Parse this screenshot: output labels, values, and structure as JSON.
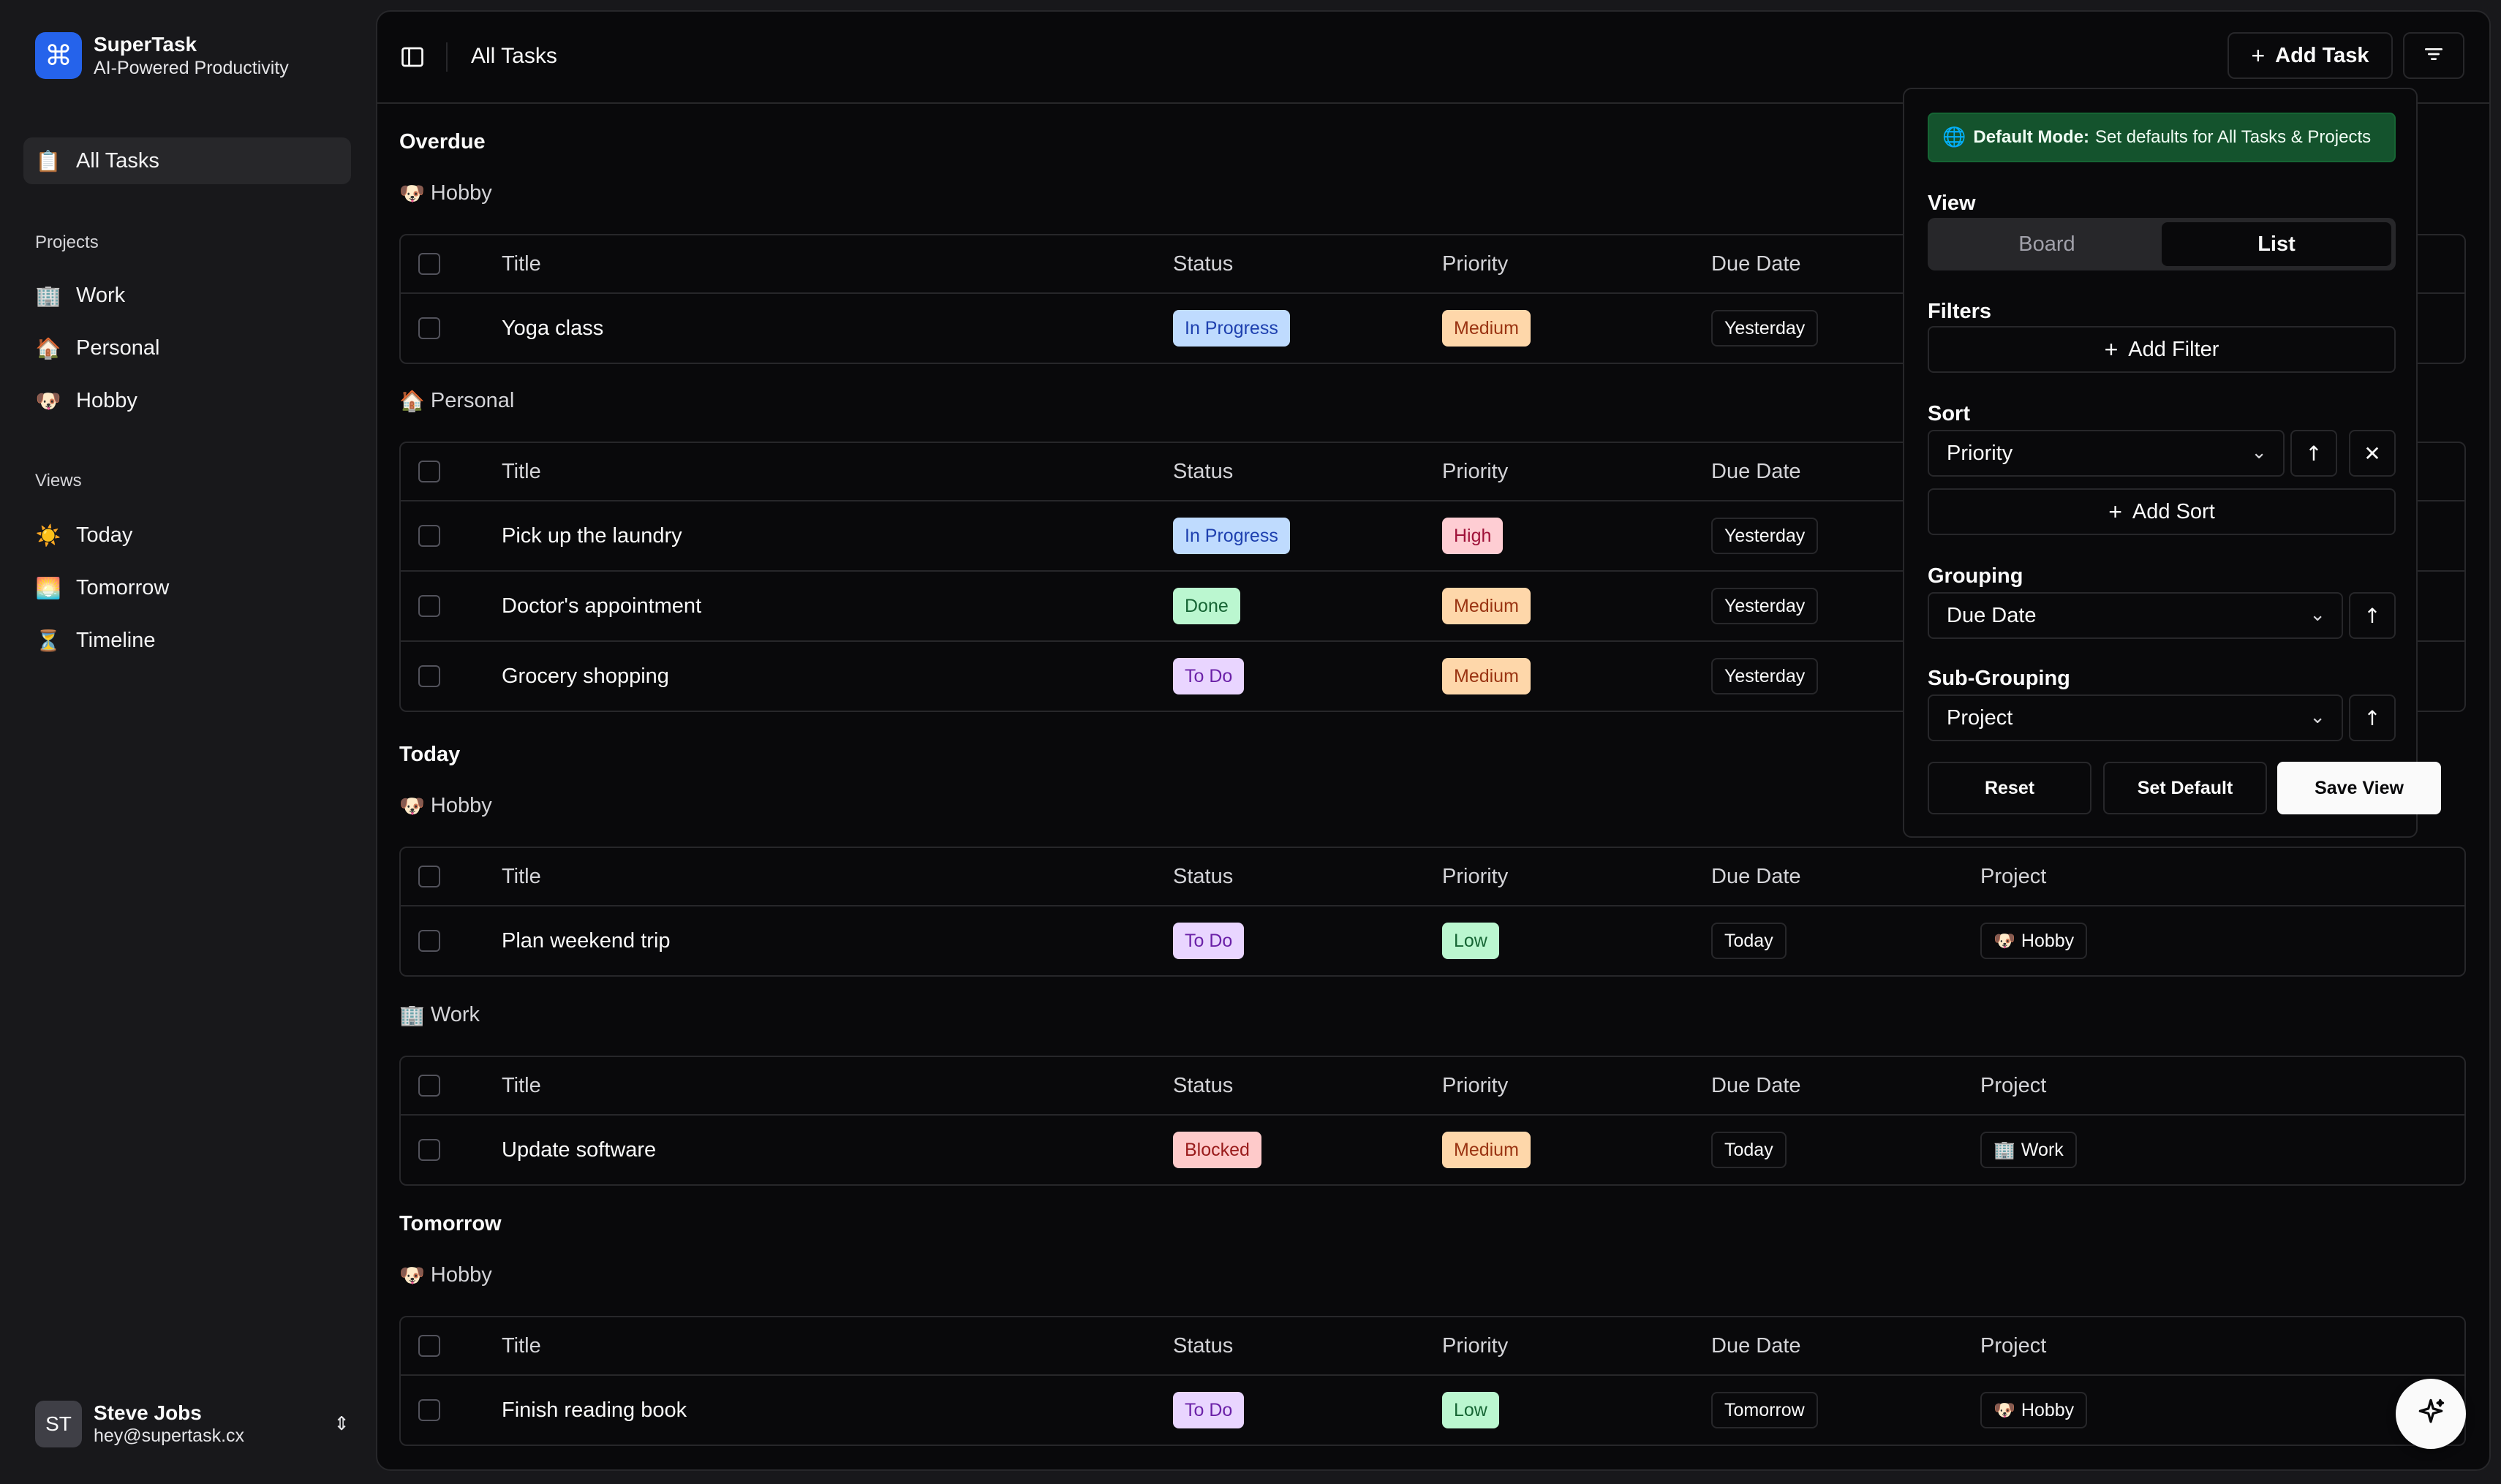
{
  "brand": {
    "logo_glyph": "⌘",
    "name": "SuperTask",
    "tagline": "AI-Powered Productivity",
    "accent": "#2563eb"
  },
  "sidebar": {
    "all_tasks": {
      "emoji": "📋",
      "label": "All Tasks"
    },
    "projects_heading": "Projects",
    "projects": [
      {
        "emoji": "🏢",
        "label": "Work"
      },
      {
        "emoji": "🏠",
        "label": "Personal"
      },
      {
        "emoji": "🐶",
        "label": "Hobby"
      }
    ],
    "views_heading": "Views",
    "views": [
      {
        "emoji": "☀️",
        "label": "Today"
      },
      {
        "emoji": "🌅",
        "label": "Tomorrow"
      },
      {
        "emoji": "⏳",
        "label": "Timeline"
      }
    ]
  },
  "user": {
    "initials": "ST",
    "name": "Steve Jobs",
    "email": "hey@supertask.cx",
    "chevron": "⇕"
  },
  "header": {
    "title": "All Tasks",
    "add_task": "Add Task",
    "plus": "+"
  },
  "columns": {
    "title": "Title",
    "status": "Status",
    "priority": "Priority",
    "due": "Due Date",
    "project": "Project"
  },
  "groups": {
    "overdue": {
      "label": "Overdue",
      "hobby": {
        "emoji": "🐶",
        "label": "Hobby",
        "rows": [
          {
            "title": "Yoga class",
            "status": "In Progress",
            "priority": "Medium",
            "due": "Yesterday"
          }
        ]
      },
      "personal": {
        "emoji": "🏠",
        "label": "Personal",
        "rows": [
          {
            "title": "Pick up the laundry",
            "status": "In Progress",
            "priority": "High",
            "due": "Yesterday"
          },
          {
            "title": "Doctor's appointment",
            "status": "Done",
            "priority": "Medium",
            "due": "Yesterday"
          },
          {
            "title": "Grocery shopping",
            "status": "To Do",
            "priority": "Medium",
            "due": "Yesterday"
          }
        ]
      }
    },
    "today": {
      "label": "Today",
      "hobby": {
        "emoji": "🐶",
        "label": "Hobby",
        "rows": [
          {
            "title": "Plan weekend trip",
            "status": "To Do",
            "priority": "Low",
            "due": "Today",
            "project_emoji": "🐶",
            "project": "Hobby"
          }
        ]
      },
      "work": {
        "emoji": "🏢",
        "label": "Work",
        "rows": [
          {
            "title": "Update software",
            "status": "Blocked",
            "priority": "Medium",
            "due": "Today",
            "project_emoji": "🏢",
            "project": "Work"
          }
        ]
      }
    },
    "tomorrow": {
      "label": "Tomorrow",
      "hobby": {
        "emoji": "🐶",
        "label": "Hobby",
        "rows": [
          {
            "title": "Finish reading book",
            "status": "To Do",
            "priority": "Low",
            "due": "Tomorrow",
            "project_emoji": "🐶",
            "project": "Hobby"
          }
        ]
      }
    }
  },
  "popover": {
    "banner_icon": "🌐",
    "banner_bold": "Default Mode:",
    "banner_text": "Set defaults for All Tasks & Projects",
    "view_label": "View",
    "view_options": [
      "Board",
      "List"
    ],
    "view_selected": "List",
    "filters_label": "Filters",
    "add_filter": "Add Filter",
    "sort_label": "Sort",
    "sort_value": "Priority",
    "add_sort": "Add Sort",
    "grouping_label": "Grouping",
    "grouping_value": "Due Date",
    "subgrouping_label": "Sub-Grouping",
    "subgrouping_value": "Project",
    "reset": "Reset",
    "set_default": "Set Default",
    "save_view": "Save View",
    "glyphs": {
      "chevron": "⌄",
      "up": "↑",
      "close": "✕",
      "plus": "+"
    }
  },
  "colors": {
    "in_progress": "#bfdbfe",
    "done": "#bbf7d0",
    "todo": "#e9d5ff",
    "blocked": "#fecaca",
    "medium": "#fed7aa",
    "high": "#fecdd3",
    "low": "#bbf7d0",
    "banner": "#14532d"
  },
  "icons": [
    "sidebar-toggle-icon",
    "filter-icon",
    "sparkle-icon",
    "globe-icon",
    "arrow-up-icon",
    "close-icon",
    "chevron-down-icon",
    "plus-icon"
  ]
}
